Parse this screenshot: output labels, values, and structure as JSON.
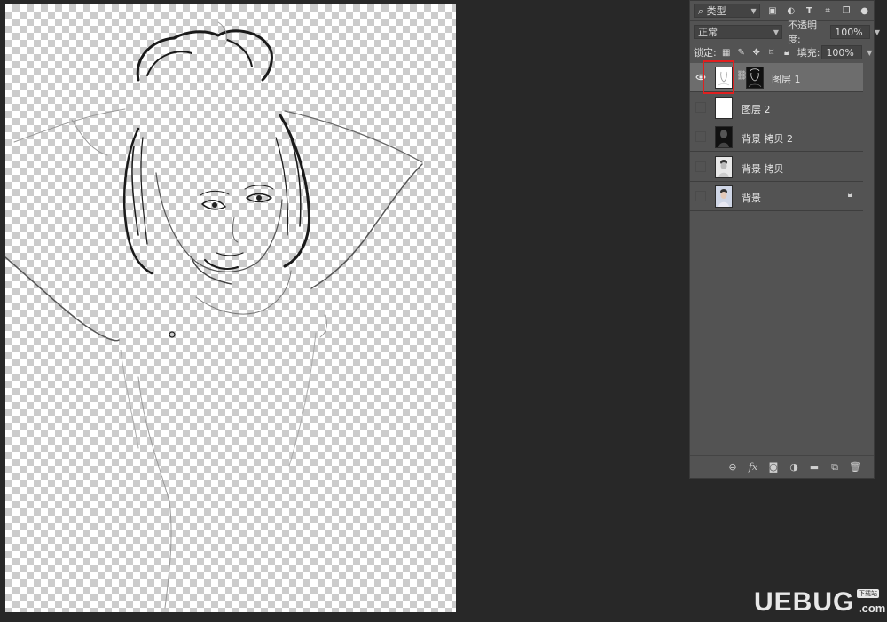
{
  "panel": {
    "filter": {
      "label": "类型",
      "icons": [
        "image-filter-icon",
        "adjustment-filter-icon",
        "type-filter-icon",
        "shape-filter-icon",
        "smart-object-filter-icon",
        "filter-toggle-icon"
      ]
    },
    "blend_mode": "正常",
    "opacity_label": "不透明度:",
    "opacity_value": "100%",
    "lock_label": "锁定:",
    "lock_icons": [
      "lock-transparent-icon",
      "lock-paint-icon",
      "lock-position-icon",
      "lock-artboard-icon",
      "lock-all-icon"
    ],
    "fill_label": "填充:",
    "fill_value": "100%"
  },
  "layers": [
    {
      "name": "图层 1",
      "visible": true,
      "active": true,
      "has_mask": true,
      "thumb": "sketch"
    },
    {
      "name": "图层 2",
      "visible": false,
      "active": false,
      "has_mask": false,
      "thumb": "white"
    },
    {
      "name": "背景 拷贝 2",
      "visible": false,
      "active": false,
      "has_mask": false,
      "thumb": "dark"
    },
    {
      "name": "背景 拷贝",
      "visible": false,
      "active": false,
      "has_mask": false,
      "thumb": "gray"
    },
    {
      "name": "背景",
      "visible": false,
      "active": false,
      "has_mask": false,
      "thumb": "photo",
      "locked": true
    }
  ],
  "bottom_icons": [
    "link-layers-icon",
    "fx-icon",
    "add-mask-icon",
    "adjustment-layer-icon",
    "group-folder-icon",
    "new-layer-icon",
    "delete-layer-icon"
  ],
  "watermark": {
    "text": "UEBUG",
    "dotcom": ".com",
    "badge": "下载站"
  },
  "colors": {
    "highlight": "#e02020",
    "panel": "#535353",
    "workspace": "#282828"
  }
}
